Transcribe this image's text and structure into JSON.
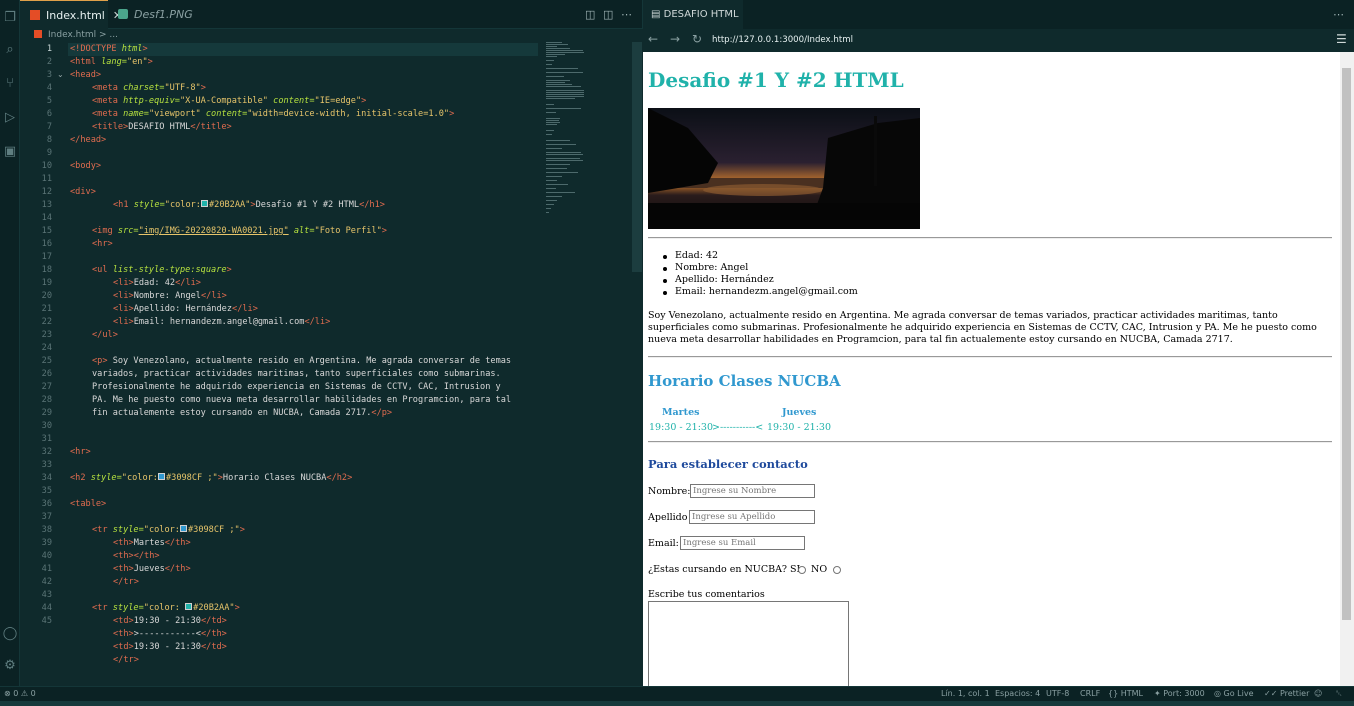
{
  "editor": {
    "tabs": [
      {
        "label": "Index.html",
        "active": true
      },
      {
        "label": "Desf1.PNG",
        "active": false
      }
    ],
    "breadcrumb": [
      "Index.html",
      "..."
    ],
    "lines": [
      {
        "n": "1"
      },
      {
        "n": "2"
      },
      {
        "n": "3"
      },
      {
        "n": "4"
      },
      {
        "n": "5"
      },
      {
        "n": "6"
      },
      {
        "n": "7"
      },
      {
        "n": "8"
      },
      {
        "n": "9"
      },
      {
        "n": "10"
      },
      {
        "n": "11"
      },
      {
        "n": "12"
      },
      {
        "n": "13"
      },
      {
        "n": "14"
      },
      {
        "n": "15"
      },
      {
        "n": "16"
      },
      {
        "n": "17"
      },
      {
        "n": "18"
      },
      {
        "n": "19"
      },
      {
        "n": "20"
      },
      {
        "n": "21"
      },
      {
        "n": "22"
      },
      {
        "n": "23"
      },
      {
        "n": "24"
      },
      {
        "n": "25"
      },
      {
        "n": "26"
      },
      {
        "n": "27"
      },
      {
        "n": "28"
      },
      {
        "n": "29"
      },
      {
        "n": "30"
      },
      {
        "n": "31"
      },
      {
        "n": "32"
      },
      {
        "n": "33"
      },
      {
        "n": "34"
      },
      {
        "n": "35"
      },
      {
        "n": "36"
      },
      {
        "n": "37"
      },
      {
        "n": "38"
      },
      {
        "n": "39"
      },
      {
        "n": "40"
      },
      {
        "n": "41"
      },
      {
        "n": "42"
      },
      {
        "n": "43"
      },
      {
        "n": "44"
      },
      {
        "n": "45"
      }
    ],
    "code": {
      "l1_tag": "<!DOCTYPE",
      "l1_attr": "html",
      "l1_end": ">",
      "l2_tag": "<html",
      "l2_attr": "lang=",
      "l2_val": "\"en\"",
      "l2_end": ">",
      "l3": "<head>",
      "l4_tag": "<meta",
      "l4_attr": "charset=",
      "l4_val": "\"UTF-8\"",
      "l4_end": ">",
      "l5_tag": "<meta",
      "l5_attr": "http-equiv=",
      "l5_val": "\"X-UA-Compatible\"",
      "l5_attr2": "content=",
      "l5_val2": "\"IE=edge\"",
      "l5_end": ">",
      "l6_tag": "<meta",
      "l6_attr": "name=",
      "l6_val": "\"viewport\"",
      "l6_attr2": "content=",
      "l6_val2": "\"width=device-width, initial-scale=1.0\"",
      "l6_end": ">",
      "l7_tag": "<title>",
      "l7_text": "DESAFIO HTML",
      "l7_end": "</title>",
      "l8": "</head>",
      "l10": "<body>",
      "l12": "<div>",
      "l13_tag": "<h1",
      "l13_attr": "style=",
      "l13_q": "\"color:",
      "l13_color": "#20B2AA\"",
      "l13_close": ">",
      "l13_text": "Desafio #1 Y #2 HTML",
      "l13_end": "</h1>",
      "l15_tag": "<img",
      "l15_attr": "src=",
      "l15_val": "\"img/IMG-20220820-WA0021.jpg\"",
      "l15_attr2": "alt=",
      "l15_val2": "\"Foto Perfil\"",
      "l15_end": ">",
      "l16": "<hr>",
      "l18_tag": "<ul",
      "l18_attr": "list-style-type:square",
      "l18_end": ">",
      "l19_tag": "<li>",
      "l19_text": "Edad: 42",
      "l19_end": "</li>",
      "l20_tag": "<li>",
      "l20_text": "Nombre: Angel",
      "l20_end": "</li>",
      "l21_tag": "<li>",
      "l21_text": "Apellido: Hernández",
      "l21_end": "</li>",
      "l22_tag": "<li>",
      "l22_text": "Email: hernandezm.angel@gmail.com",
      "l22_end": "</li>",
      "l23": "</ul>",
      "l25a_tag": "<p>",
      "l25a_text": " Soy Venezolano, actualmente resido en Argentina. Me agrada conversar de temas",
      "l25b": "variados, practicar actividades maritimas, tanto superficiales como submarinas.",
      "l25c": "Profesionalmente he adquirido experiencia en Sistemas de CCTV, CAC, Intrusion y",
      "l25d": "PA. Me he puesto como nueva meta desarrollar habilidades en Programcion, para tal",
      "l25e_text": "fin actualemente estoy cursando en NUCBA, Camada 2717.",
      "l25e_end": "</p>",
      "l28": "<hr>",
      "l30_tag": "<h2",
      "l30_attr": "style=",
      "l30_q": "\"color:",
      "l30_color": "#3098CF ;\"",
      "l30_close": ">",
      "l30_text": "Horario Clases NUCBA",
      "l30_end": "</h2>",
      "l32": "<table>",
      "l34_tag": "<tr",
      "l34_attr": "style=",
      "l34_q": "\"color:",
      "l34_color": "#3098CF ;\"",
      "l34_end": ">",
      "l35_tag": "<th>",
      "l35_text": "Martes",
      "l35_end": "</th>",
      "l36_tag": "<th>",
      "l36_end": "</th>",
      "l37_tag": "<th>",
      "l37_text": "Jueves",
      "l37_end": "</th>",
      "l38": "</tr>",
      "l40_tag": "<tr",
      "l40_attr": "style=",
      "l40_q": "\"color: ",
      "l40_color": "#20B2AA\"",
      "l40_end": ">",
      "l41_tag": "<td>",
      "l41_text": "19:30 - 21:30",
      "l41_end": "</td>",
      "l42_tag": "<th>",
      "l42_text": ">-----------<",
      "l42_end": "</th>",
      "l43_tag": "<td>",
      "l43_text": "19:30 - 21:30",
      "l43_end": "</td>",
      "l44": "</tr>"
    },
    "colors": {
      "swatch_teal": "#20B2AA",
      "swatch_blue": "#3098CF"
    }
  },
  "browser": {
    "tab_label": "DESAFIO HTML",
    "url": "http://127.0.0.1:3000/Index.html",
    "page": {
      "h1": "Desafio #1 Y #2 HTML",
      "list": [
        "Edad: 42",
        "Nombre: Angel",
        "Apellido: Hernández",
        "Email: hernandezm.angel@gmail.com"
      ],
      "paragraph": "Soy Venezolano, actualmente resido en Argentina. Me agrada conversar de temas variados, practicar actividades maritimas, tanto superficiales como submarinas. Profesionalmente he adquirido experiencia en Sistemas de CCTV, CAC, Intrusion y PA. Me he puesto como nueva meta desarrollar habilidades en Programcion, para tal fin actualemente estoy cursando en NUCBA, Camada 2717.",
      "h2": "Horario Clases NUCBA",
      "table_headers": [
        "Martes",
        "",
        "Jueves"
      ],
      "table_row": [
        "19:30 - 21:30",
        ">-----------<",
        "19:30 - 21:30"
      ],
      "contact_title": "Para establecer contacto",
      "nombre_label": "Nombre:",
      "nombre_placeholder": "Ingrese su Nombre",
      "apellido_label": "Apellido",
      "apellido_placeholder": "Ingrese su Apellido",
      "email_label": "Email:",
      "email_placeholder": "Ingrese su Email",
      "nucba_question": "¿Estas cursando en NUCBA? SI",
      "no_label": "NO",
      "comments_label": "Escribe tus comentarios"
    }
  },
  "status": {
    "errors": "0",
    "warnings": "0",
    "position": "Lín. 1, col. 1",
    "spaces": "Espacios: 4",
    "encoding": "UTF-8",
    "eol": "CRLF",
    "language": "HTML",
    "port": "Port: 3000",
    "golive": "Go Live",
    "prettier": "Prettier"
  }
}
